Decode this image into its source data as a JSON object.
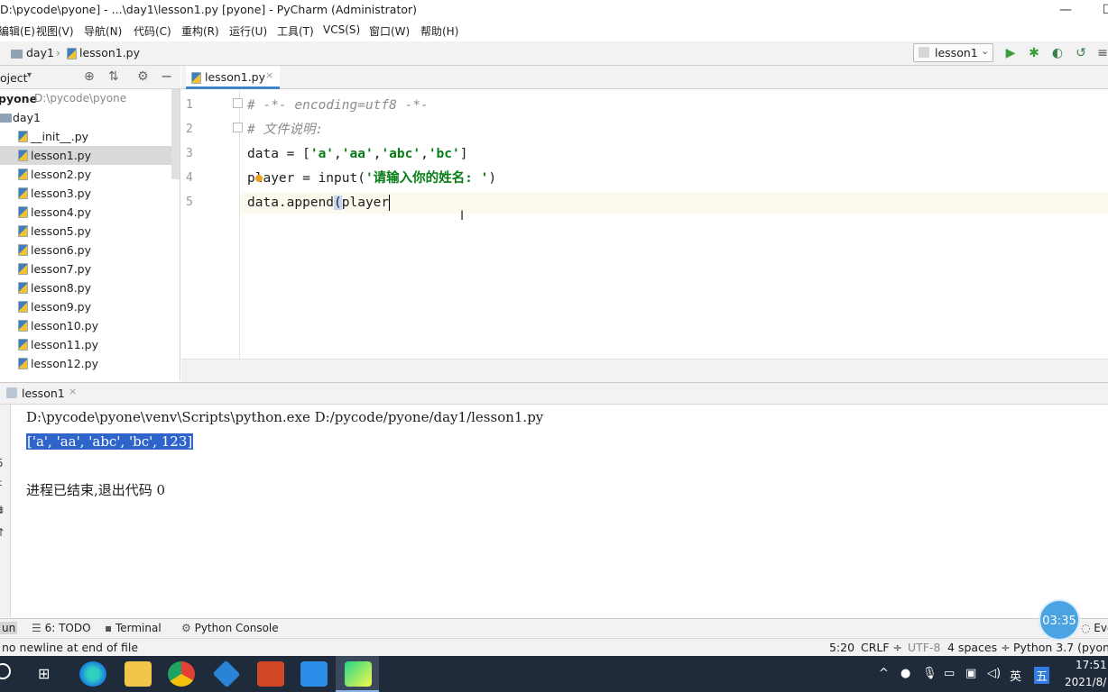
{
  "window": {
    "title": "D:\\pycode\\pyone] - ...\\day1\\lesson1.py [pyone] - PyCharm (Administrator)",
    "minimize": "—",
    "restore": "☐"
  },
  "menu": [
    "编辑(E)",
    "视图(V)",
    "导航(N)",
    "代码(C)",
    "重构(R)",
    "运行(U)",
    "工具(T)",
    "VCS(S)",
    "窗口(W)",
    "帮助(H)"
  ],
  "breadcrumb": {
    "folder": "day1",
    "file": "lesson1.py"
  },
  "run_config": {
    "label": "lesson1"
  },
  "project_panel": {
    "title": "oject",
    "root_name": "pyone",
    "root_path": "D:\\pycode\\pyone",
    "folder": "day1",
    "files": [
      "__init__.py",
      "lesson1.py",
      "lesson2.py",
      "lesson3.py",
      "lesson4.py",
      "lesson5.py",
      "lesson6.py",
      "lesson7.py",
      "lesson8.py",
      "lesson9.py",
      "lesson10.py",
      "lesson11.py",
      "lesson12.py"
    ]
  },
  "editor": {
    "tab": "lesson1.py",
    "line_numbers": [
      "1",
      "2",
      "3",
      "4",
      "5"
    ],
    "lines": {
      "l1": "# -*- encoding=utf8 -*-",
      "l2": "# 文件说明:",
      "l3a": "data = [",
      "l3b": "'a'",
      "l3c": ",",
      "l3d": "'aa'",
      "l3e": ",",
      "l3f": "'abc'",
      "l3g": ",",
      "l3h": "'bc'",
      "l3i": "]",
      "l4a": "player = input(",
      "l4b": "'请输入你的姓名: '",
      "l4c": ")",
      "l5a": "data.append",
      "l5b": "(",
      "l5c": "player",
      ")l5d": ")"
    }
  },
  "run_panel": {
    "tab": "lesson1",
    "cmd": "D:\\pycode\\pyone\\venv\\Scripts\\python.exe D:/pycode/pyone/day1/lesson1.py",
    "output": "['a', 'aa', 'abc', 'bc', 123]",
    "exit": "进程已结束,退出代码 0",
    "side_chars": [
      "5",
      "‡",
      "⇟",
      "↑"
    ]
  },
  "toolwindows": {
    "run": "un",
    "todo": "6: TODO",
    "terminal": "Terminal",
    "console": "Python Console",
    "event": "Eve"
  },
  "status": {
    "message": "no newline at end of file",
    "pos": "5:20",
    "crlf": "CRLF ÷",
    "enc": "UTF-8",
    "indent": "4 spaces ÷",
    "interp": "Python 3.7 (pyone"
  },
  "timer": "03:35",
  "taskbar": {
    "ime": "英",
    "ime2": "五",
    "time": "17:51",
    "date": "2021/8/"
  },
  "colors": {
    "accent": "#4083c9",
    "selection": "#2f65ca",
    "current_line": "#fcfaed",
    "taskbar": "#1f2b3a"
  }
}
